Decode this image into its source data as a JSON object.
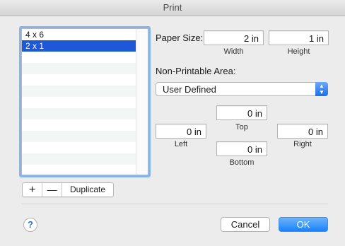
{
  "window": {
    "title": "Print"
  },
  "paper_list": {
    "items": [
      {
        "label": "4 x 6",
        "selected": false
      },
      {
        "label": "2 x 1",
        "selected": true
      }
    ]
  },
  "list_buttons": {
    "add": "+",
    "remove": "—",
    "duplicate": "Duplicate"
  },
  "paper_size": {
    "label": "Paper Size:",
    "width_value": "2 in",
    "width_label": "Width",
    "height_value": "1 in",
    "height_label": "Height"
  },
  "non_printable": {
    "label": "Non-Printable Area:",
    "selected_option": "User Defined",
    "top_value": "0 in",
    "top_label": "Top",
    "left_value": "0 in",
    "left_label": "Left",
    "right_value": "0 in",
    "right_label": "Right",
    "bottom_value": "0 in",
    "bottom_label": "Bottom"
  },
  "footer": {
    "help": "?",
    "cancel": "Cancel",
    "ok": "OK"
  },
  "colors": {
    "accent": "#1c58d8",
    "ok_button": "#1a82fb"
  }
}
